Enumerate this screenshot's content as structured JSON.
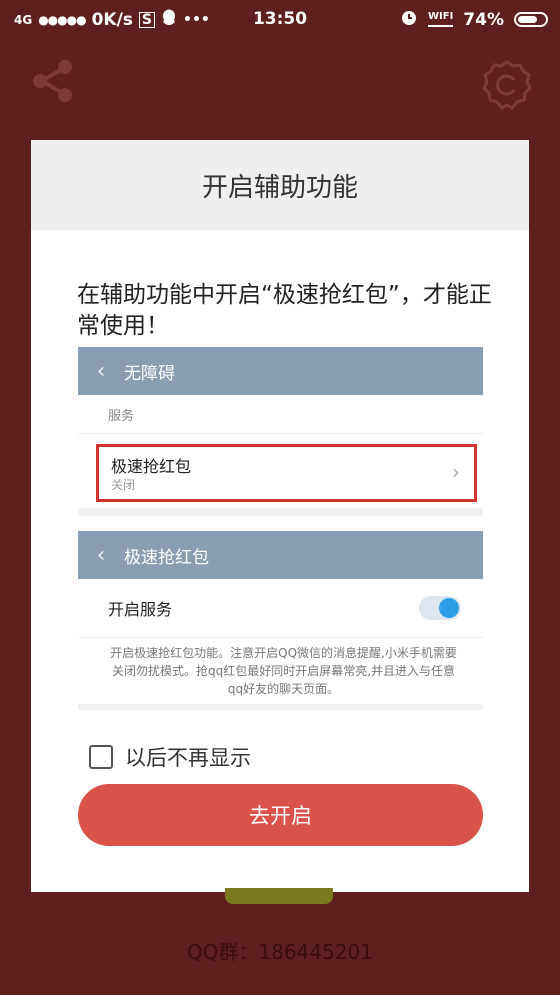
{
  "status_bar": {
    "network": "4G",
    "signal": "●●●●●",
    "speed": "0K/s",
    "time": "13:50",
    "wifi": "WIFI",
    "battery": "74%",
    "battery_level": 0.74
  },
  "dialog": {
    "title": "开启辅助功能",
    "instruction": "在辅助功能中开启“极速抢红包”，才能正常使用！",
    "mock1": {
      "header": "无障碍",
      "section": "服务",
      "item_title": "极速抢红包",
      "item_status": "关闭"
    },
    "mock2": {
      "header": "极速抢红包",
      "toggle_label": "开启服务",
      "description": "开启极速抢红包功能。注意开启QQ微信的消息提醒,小米手机需要关闭勿扰模式。抢qq红包最好同时开启屏幕常亮,并且进入与任意qq好友的聊天页面。"
    },
    "checkbox_label": "以后不再显示",
    "primary_button": "去开启"
  },
  "footer": {
    "text": "QQ群：186445201"
  },
  "colors": {
    "background": "#5e1f1f",
    "accent_button": "#d9534a",
    "mock_bar": "#8a9db2",
    "highlight_border": "#d0342c",
    "toggle_on": "#2d9ee6"
  },
  "icons": [
    "share-icon",
    "settings-icon",
    "alarm-icon",
    "qq-icon",
    "chevron-left-icon",
    "chevron-right-icon"
  ]
}
